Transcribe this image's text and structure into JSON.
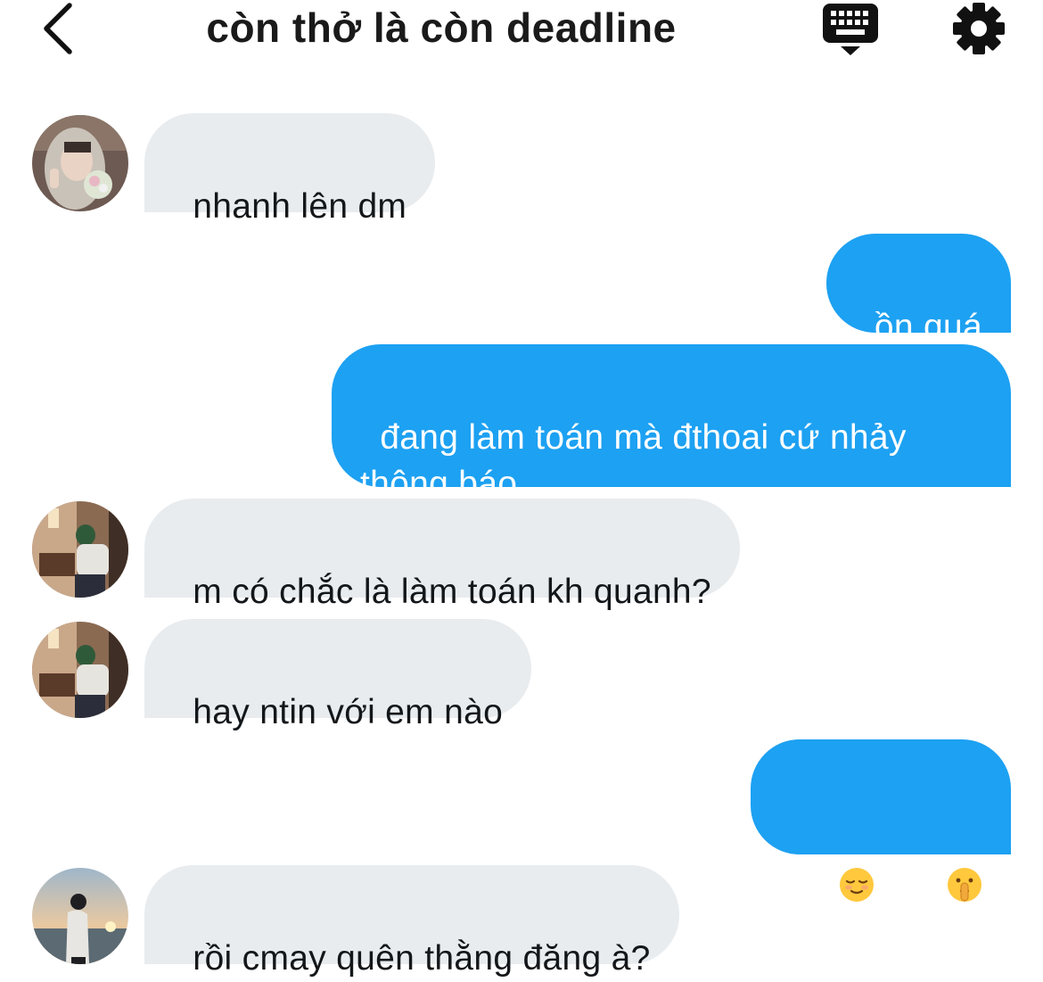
{
  "header": {
    "title": "còn thở là còn deadline",
    "back_icon": "chevron-left-icon",
    "keyboard_icon": "keyboard-icon",
    "settings_icon": "gear-icon"
  },
  "colors": {
    "outgoing_bubble": "#1da1f2",
    "incoming_bubble": "#e8ecef",
    "outgoing_text": "#ffffff",
    "incoming_text": "#14171a"
  },
  "messages": [
    {
      "direction": "in",
      "text": "nhanh lên dm",
      "avatar": "avatar-hooded-girl"
    },
    {
      "direction": "out",
      "text": "ồn quá"
    },
    {
      "direction": "out",
      "text": "đang làm toán mà đthoai cứ nhảy\nthông báo"
    },
    {
      "direction": "in",
      "text": "m có chắc là làm toán kh quanh?",
      "avatar": "avatar-boy-headphones"
    },
    {
      "direction": "in",
      "text": "hay ntin với em nào",
      "avatar": "avatar-boy-headphones"
    },
    {
      "direction": "out",
      "emojis": [
        "😌",
        "🤫"
      ]
    },
    {
      "direction": "in",
      "text": "rồi cmay quên thằng đăng à?",
      "avatar": "avatar-sunset-silhouette"
    }
  ]
}
